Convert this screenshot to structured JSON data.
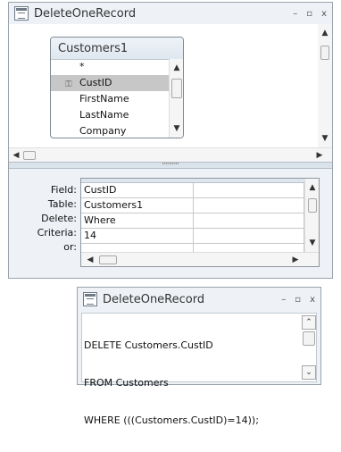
{
  "query_window": {
    "title": "DeleteOneRecord",
    "controls": {
      "minimize": "–",
      "maximize": "▫",
      "close": "x"
    },
    "table": {
      "name": "Customers1",
      "fields": [
        {
          "label": "*"
        },
        {
          "label": "CustID",
          "key": true,
          "selected": true
        },
        {
          "label": "FirstName"
        },
        {
          "label": "LastName"
        },
        {
          "label": "Company"
        }
      ]
    },
    "grid": {
      "row_labels": [
        "Field:",
        "Table:",
        "Delete:",
        "Criteria:",
        "or:"
      ],
      "columns": [
        {
          "values": [
            "CustID",
            "Customers1",
            "Where",
            "14",
            ""
          ]
        },
        {
          "values": [
            "",
            "",
            "",
            "",
            ""
          ]
        },
        {
          "values": [
            "",
            "",
            "",
            "",
            ""
          ]
        }
      ]
    },
    "splitter_glyph": "''''''''''"
  },
  "sql_window": {
    "title": "DeleteOneRecord",
    "controls": {
      "minimize": "–",
      "maximize": "▫",
      "close": "x"
    },
    "sql_lines": [
      "DELETE Customers.CustID",
      "FROM Customers",
      "WHERE (((Customers.CustID)=14));"
    ]
  },
  "colors": {
    "window_bg": "#eef2f6",
    "selected_row": "#c7c7c7",
    "border": "#9aa3ad"
  }
}
